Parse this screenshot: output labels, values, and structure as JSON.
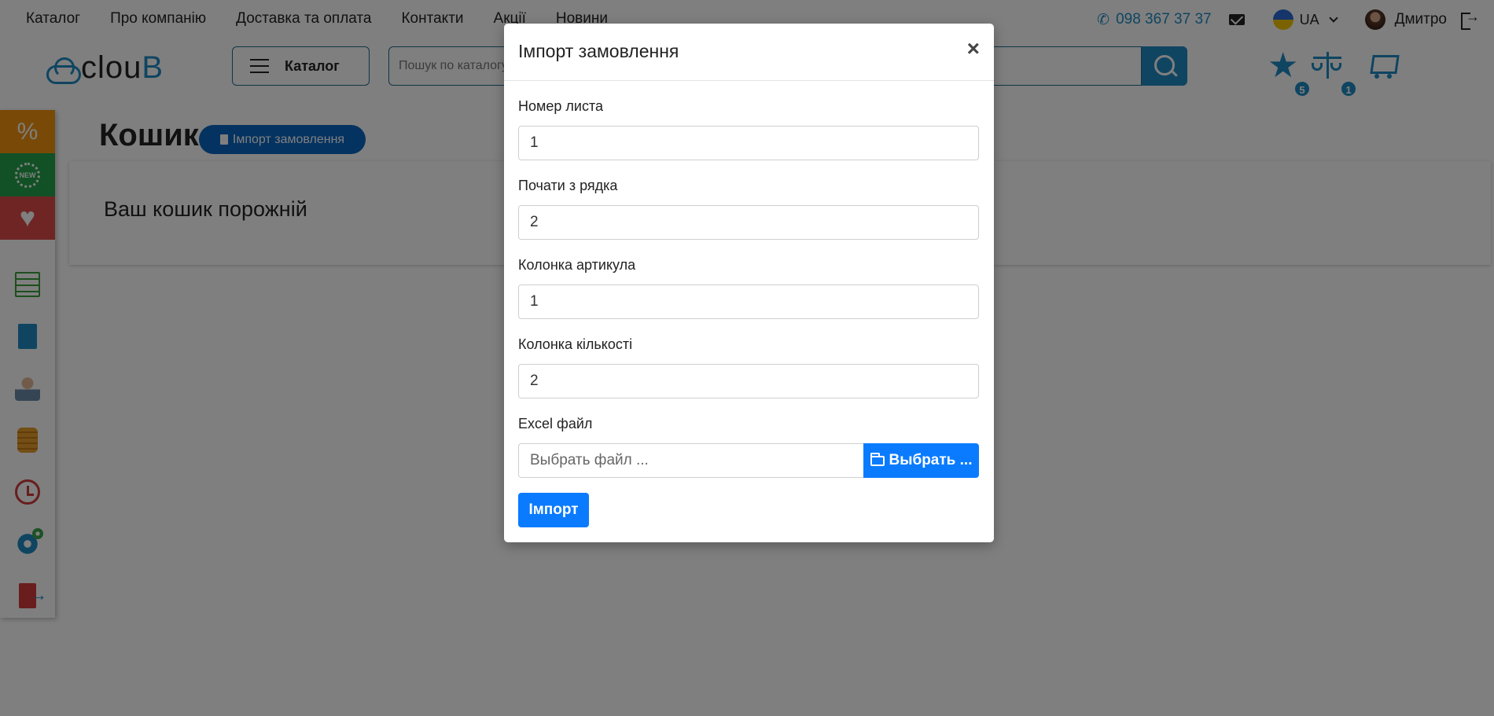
{
  "top_nav": [
    "Каталог",
    "Про компанію",
    "Доставка та оплата",
    "Контакти",
    "Акції",
    "Новини"
  ],
  "contact": {
    "phone": "098 367 37 37"
  },
  "language": {
    "selected": "UA"
  },
  "user": {
    "name": "Дмитро"
  },
  "header": {
    "logo_prefix": "clou",
    "logo_accent": "B",
    "catalog_label": "Каталог",
    "search_placeholder": "Пошук по каталогу"
  },
  "badges": {
    "favorites": "5",
    "compare": "1"
  },
  "page": {
    "title": "Кошик",
    "import_button": "Імпорт замовлення",
    "empty_message": "Ваш кошик порожній"
  },
  "modal": {
    "title": "Імпорт замовлення",
    "close": "×",
    "fields": [
      {
        "label": "Номер листа",
        "value": "1"
      },
      {
        "label": "Почати з рядка",
        "value": "2"
      },
      {
        "label": "Колонка артикула",
        "value": "1"
      },
      {
        "label": "Колонка кількості",
        "value": "2"
      }
    ],
    "file": {
      "label": "Excel файл",
      "placeholder": "Выбрать файл ...",
      "button": "Выбрать ..."
    },
    "submit": "Імпорт"
  },
  "colors": {
    "accent": "#1e8bc3",
    "primary_button": "#0a7bff"
  }
}
